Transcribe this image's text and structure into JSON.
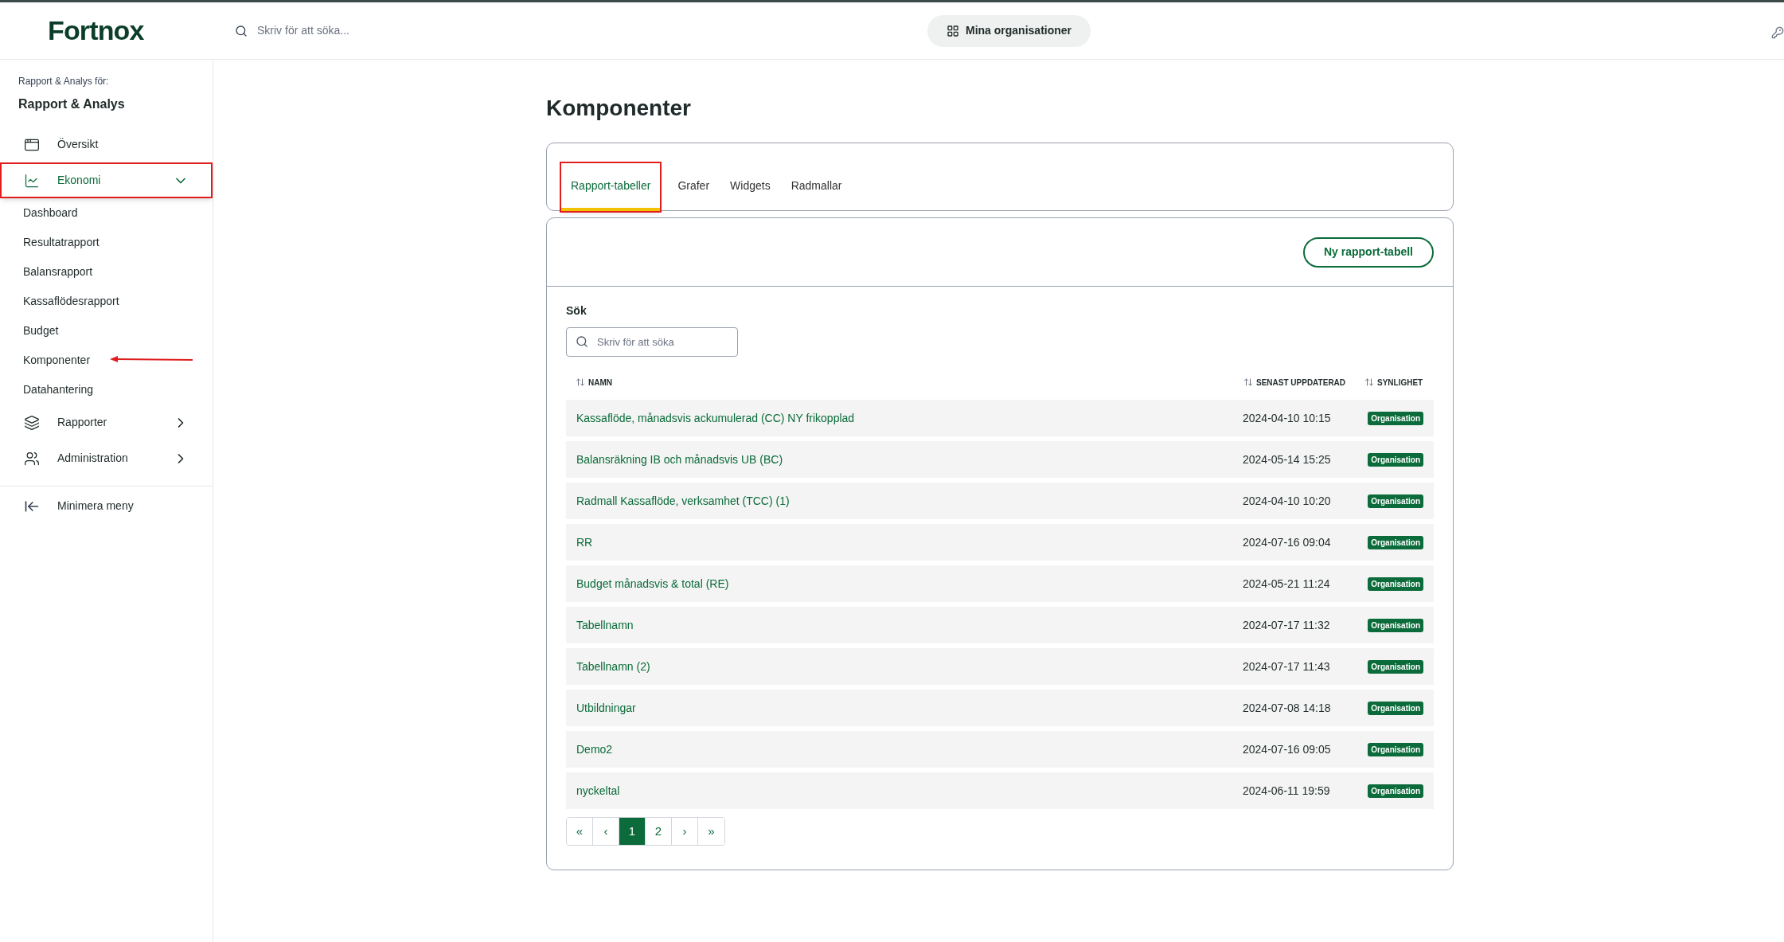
{
  "header": {
    "logo": "Fortnox",
    "search_placeholder": "Skriv för att söka...",
    "org_button": "Mina organisationer"
  },
  "sidebar": {
    "subtitle": "Rapport & Analys för:",
    "title": "Rapport & Analys",
    "items": [
      {
        "label": "Översikt",
        "selected": false,
        "annotated": false
      },
      {
        "label": "Ekonomi",
        "selected": true,
        "annotated": true,
        "expanded": true,
        "children": [
          {
            "label": "Dashboard",
            "arrow": false
          },
          {
            "label": "Resultatrapport",
            "arrow": false
          },
          {
            "label": "Balansrapport",
            "arrow": false
          },
          {
            "label": "Kassaflödesrapport",
            "arrow": false
          },
          {
            "label": "Budget",
            "arrow": false
          },
          {
            "label": "Komponenter",
            "arrow": true
          },
          {
            "label": "Datahantering",
            "arrow": false
          }
        ]
      },
      {
        "label": "Rapporter",
        "selected": false,
        "annotated": false,
        "expanded": false
      },
      {
        "label": "Administration",
        "selected": false,
        "annotated": false,
        "expanded": false
      }
    ],
    "collapse": "Minimera meny"
  },
  "page_title": "Komponenter",
  "tabs": [
    {
      "label": "Rapport-tabeller",
      "selected": true,
      "annotated": true
    },
    {
      "label": "Grafer",
      "selected": false,
      "annotated": false
    },
    {
      "label": "Widgets",
      "selected": false,
      "annotated": false
    },
    {
      "label": "Radmallar",
      "selected": false,
      "annotated": false
    }
  ],
  "new_button": "Ny rapport-tabell",
  "search": {
    "label": "Sök",
    "placeholder": "Skriv för att söka"
  },
  "table": {
    "columns": [
      "NAMN",
      "SENAST UPPDATERAD",
      "SYNLIGHET"
    ],
    "rows": [
      {
        "name": "Kassaflöde, månadsvis ackumulerad (CC) NY frikopplad",
        "updated": "2024-04-10 10:15",
        "visibility": "Organisation"
      },
      {
        "name": "Balansräkning IB och månadsvis UB (BC)",
        "updated": "2024-05-14 15:25",
        "visibility": "Organisation"
      },
      {
        "name": "Radmall Kassaflöde, verksamhet (TCC) (1)",
        "updated": "2024-04-10 10:20",
        "visibility": "Organisation"
      },
      {
        "name": "RR",
        "updated": "2024-07-16 09:04",
        "visibility": "Organisation"
      },
      {
        "name": "Budget månadsvis & total (RE)",
        "updated": "2024-05-21 11:24",
        "visibility": "Organisation"
      },
      {
        "name": "Tabellnamn",
        "updated": "2024-07-17 11:32",
        "visibility": "Organisation"
      },
      {
        "name": "Tabellnamn (2)",
        "updated": "2024-07-17 11:43",
        "visibility": "Organisation"
      },
      {
        "name": "Utbildningar",
        "updated": "2024-07-08 14:18",
        "visibility": "Organisation"
      },
      {
        "name": "Demo2",
        "updated": "2024-07-16 09:05",
        "visibility": "Organisation"
      },
      {
        "name": "nyckeltal",
        "updated": "2024-06-11 19:59",
        "visibility": "Organisation"
      }
    ]
  },
  "pagination": [
    {
      "label": "«",
      "selected": false
    },
    {
      "label": "‹",
      "selected": false
    },
    {
      "label": "1",
      "selected": true
    },
    {
      "label": "2",
      "selected": false
    },
    {
      "label": "›",
      "selected": false
    },
    {
      "label": "»",
      "selected": false
    }
  ]
}
